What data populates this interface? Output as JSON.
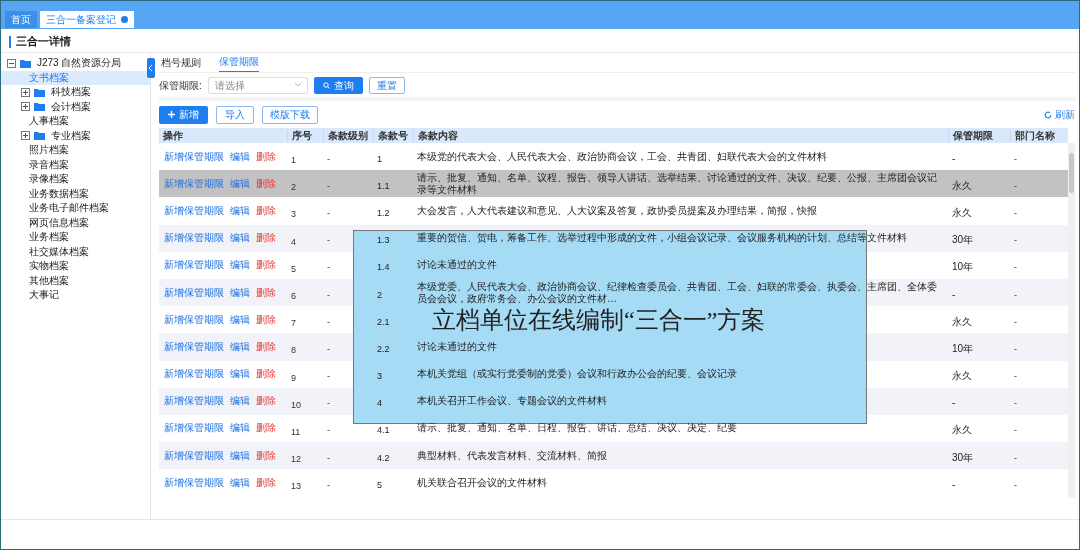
{
  "tabs": [
    {
      "label": "首页",
      "selected": false,
      "closable": false
    },
    {
      "label": "三合一备案登记",
      "selected": true,
      "closable": true
    }
  ],
  "page_title": "三合一详情",
  "tree": [
    {
      "label": "J273 自然资源分局",
      "kind": "folder",
      "expanded": true,
      "selected": false,
      "children": [
        {
          "label": "文书档案",
          "kind": "leaf",
          "selected": true
        },
        {
          "label": "科技档案",
          "kind": "folder",
          "expanded": false,
          "selected": false
        },
        {
          "label": "会计档案",
          "kind": "folder",
          "expanded": false,
          "selected": false
        },
        {
          "label": "人事档案",
          "kind": "leaf",
          "selected": false
        },
        {
          "label": "专业档案",
          "kind": "folder",
          "expanded": false,
          "selected": false
        },
        {
          "label": "照片档案",
          "kind": "leaf",
          "selected": false
        },
        {
          "label": "录音档案",
          "kind": "leaf",
          "selected": false
        },
        {
          "label": "录像档案",
          "kind": "leaf",
          "selected": false
        },
        {
          "label": "业务数据档案",
          "kind": "leaf",
          "selected": false
        },
        {
          "label": "业务电子邮件档案",
          "kind": "leaf",
          "selected": false
        },
        {
          "label": "网页信息档案",
          "kind": "leaf",
          "selected": false
        },
        {
          "label": "业务档案",
          "kind": "leaf",
          "selected": false
        },
        {
          "label": "社交媒体档案",
          "kind": "leaf",
          "selected": false
        },
        {
          "label": "实物档案",
          "kind": "leaf",
          "selected": false
        },
        {
          "label": "其他档案",
          "kind": "leaf",
          "selected": false
        },
        {
          "label": "大事记",
          "kind": "leaf",
          "selected": false
        }
      ]
    }
  ],
  "sub_tabs": [
    {
      "label": "档号规则",
      "selected": false
    },
    {
      "label": "保管期限",
      "selected": true
    }
  ],
  "filter": {
    "label": "保管期限:",
    "placeholder": "请选择",
    "search_button": "查询",
    "reset_button": "重置"
  },
  "toolbar": {
    "add_button": "新增",
    "import_button": "导入",
    "template_button": "模版下载",
    "refresh": "刷新"
  },
  "table": {
    "columns": [
      "操作",
      "序号",
      "条款级别",
      "条款号",
      "条款内容",
      "保管期限",
      "部门名称"
    ],
    "rows": [
      {
        "actions": [
          "新增保管期限",
          "编辑",
          "删除"
        ],
        "seq": "1",
        "level": "-",
        "clause": "1",
        "content": "本级党的代表大会、人民代表大会、政治协商会议，工会、共青团、妇联代表大会的文件材料",
        "period": "-",
        "dept": "-",
        "selected": false
      },
      {
        "actions": [
          "新增保管期限",
          "编辑",
          "删除"
        ],
        "seq": "2",
        "level": "-",
        "clause": "1.1",
        "content": "请示、批复、通知、名单、议程、报告、领导人讲话、选举结果、讨论通过的文件、决议、纪要、公报、主席团会议记录等文件材料",
        "period": "永久",
        "dept": "-",
        "selected": true
      },
      {
        "actions": [
          "新增保管期限",
          "编辑",
          "删除"
        ],
        "seq": "3",
        "level": "-",
        "clause": "1.2",
        "content": "大会发言，人大代表建议和意见、人大议案及答复，政协委员提案及办理结果，简报，快报",
        "period": "永久",
        "dept": "-",
        "selected": false
      },
      {
        "actions": [
          "新增保管期限",
          "编辑",
          "删除"
        ],
        "seq": "4",
        "level": "-",
        "clause": "1.3",
        "content": "重要的贺信、贺电，筹备工作、选举过程中形成的文件，小组会议记录、会议服务机构的计划、总结等文件材料",
        "period": "30年",
        "dept": "-",
        "selected": false
      },
      {
        "actions": [
          "新增保管期限",
          "编辑",
          "删除"
        ],
        "seq": "5",
        "level": "-",
        "clause": "1.4",
        "content": "讨论未通过的文件",
        "period": "10年",
        "dept": "-",
        "selected": false
      },
      {
        "actions": [
          "新增保管期限",
          "编辑",
          "删除"
        ],
        "seq": "6",
        "level": "-",
        "clause": "2",
        "content": "本级党委、人民代表大会、政治协商会议、纪律检查委员会、共青团、工会、妇联的常委会、执委会、主席团、全体委员会会议，政府常务会、办公会议的文件材…",
        "period": "-",
        "dept": "-",
        "selected": false
      },
      {
        "actions": [
          "新增保管期限",
          "编辑",
          "删除"
        ],
        "seq": "7",
        "level": "-",
        "clause": "2.1",
        "period": "永久",
        "dept": "-",
        "selected": false
      },
      {
        "actions": [
          "新增保管期限",
          "编辑",
          "删除"
        ],
        "seq": "8",
        "level": "-",
        "clause": "2.2",
        "content": "讨论未通过的文件",
        "period": "10年",
        "dept": "-",
        "selected": false
      },
      {
        "actions": [
          "新增保管期限",
          "编辑",
          "删除"
        ],
        "seq": "9",
        "level": "-",
        "clause": "3",
        "content": "本机关党组（或实行党委制的党委）会议和行政办公会的纪要、会议记录",
        "period": "永久",
        "dept": "-",
        "selected": false
      },
      {
        "actions": [
          "新增保管期限",
          "编辑",
          "删除"
        ],
        "seq": "10",
        "level": "-",
        "clause": "4",
        "content": "本机关召开工作会议、专题会议的文件材料",
        "period": "-",
        "dept": "-",
        "selected": false
      },
      {
        "actions": [
          "新增保管期限",
          "编辑",
          "删除"
        ],
        "seq": "11",
        "level": "-",
        "clause": "4.1",
        "content": "请示、批复、通知、名单、日程、报告、讲话、总结、决议、决定、纪要",
        "period": "永久",
        "dept": "-",
        "selected": false
      },
      {
        "actions": [
          "新增保管期限",
          "编辑",
          "删除"
        ],
        "seq": "12",
        "level": "-",
        "clause": "4.2",
        "content": "典型材料、代表发言材料、交流材料、简报",
        "period": "30年",
        "dept": "-",
        "selected": false
      },
      {
        "actions": [
          "新增保管期限",
          "编辑",
          "删除"
        ],
        "seq": "13",
        "level": "-",
        "clause": "5",
        "content": "机关联合召开会议的文件材料",
        "period": "-",
        "dept": "-",
        "selected": false
      }
    ]
  },
  "caption": "立档单位在线编制“三合一”方案"
}
